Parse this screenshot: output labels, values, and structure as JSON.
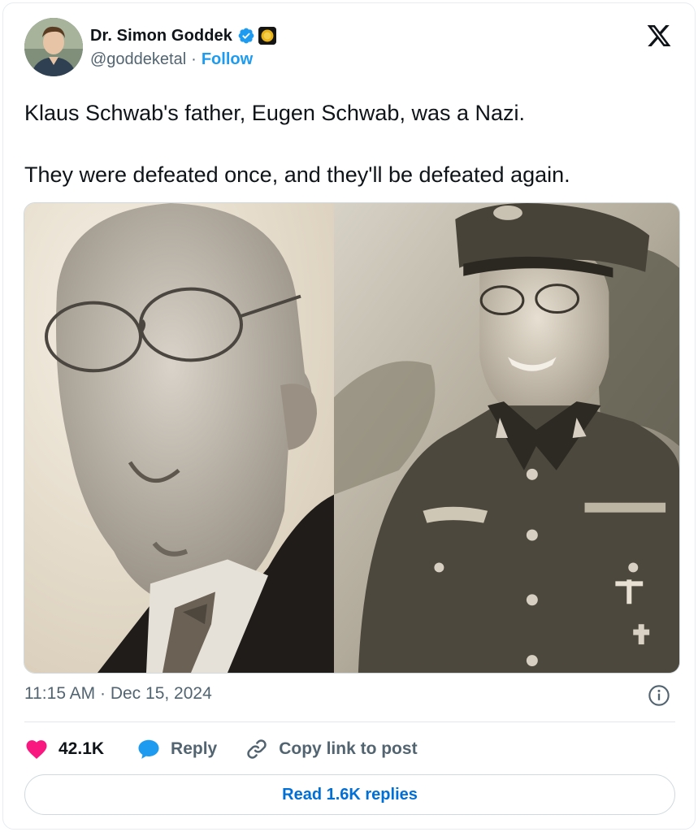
{
  "author": {
    "name": "Dr. Simon Goddek",
    "handle": "@goddeketal",
    "separator": "·",
    "follow_label": "Follow",
    "verified_color": "#1d9bf0"
  },
  "tweet": {
    "line1": "Klaus Schwab's father, Eugen Schwab, was a Nazi.",
    "line2": "They were defeated once, and they'll be defeated again.",
    "media": {
      "left_photo": "portrait-photo",
      "right_photo": "uniform-photo"
    },
    "timestamp": "11:15 AM · Dec 15, 2024"
  },
  "actions": {
    "likes": "42.1K",
    "reply_label": "Reply",
    "copy_label": "Copy link to post",
    "like_color": "#f91880",
    "reply_color": "#1d9bf0"
  },
  "footer": {
    "read_replies_label": "Read 1.6K replies"
  },
  "icons": [
    "verified-icon",
    "affiliate-badge-icon",
    "x-logo-icon",
    "info-icon",
    "heart-icon",
    "reply-bubble-icon",
    "link-icon"
  ]
}
